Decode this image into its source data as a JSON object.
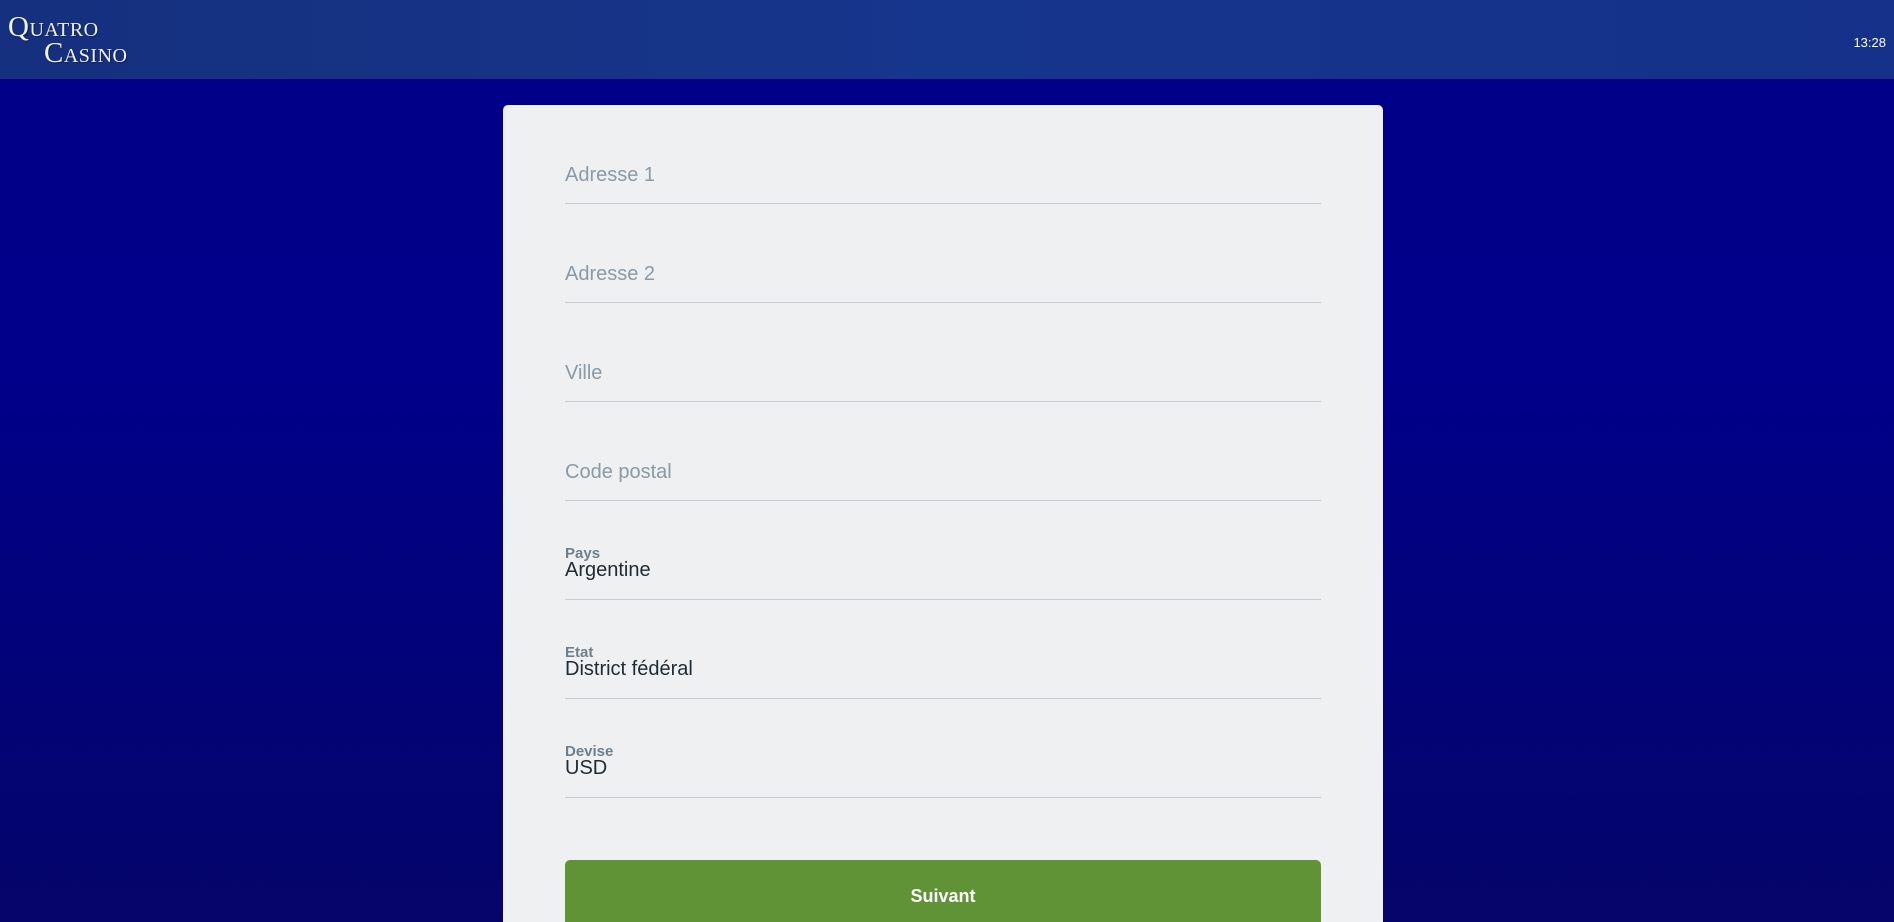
{
  "header": {
    "logo_line1": "Quatro",
    "logo_line2": "Casino",
    "time": "13:28"
  },
  "form": {
    "address1_placeholder": "Adresse 1",
    "address2_placeholder": "Adresse 2",
    "city_placeholder": "Ville",
    "postal_placeholder": "Code postal",
    "country_label": "Pays",
    "country_value": "Argentine",
    "state_label": "Etat",
    "state_value": "District fédéral",
    "currency_label": "Devise",
    "currency_value": "USD",
    "next_label": "Suivant"
  },
  "colors": {
    "background": "#000088",
    "header": "#16358c",
    "card": "#eef0f2",
    "button": "#5f9336"
  }
}
